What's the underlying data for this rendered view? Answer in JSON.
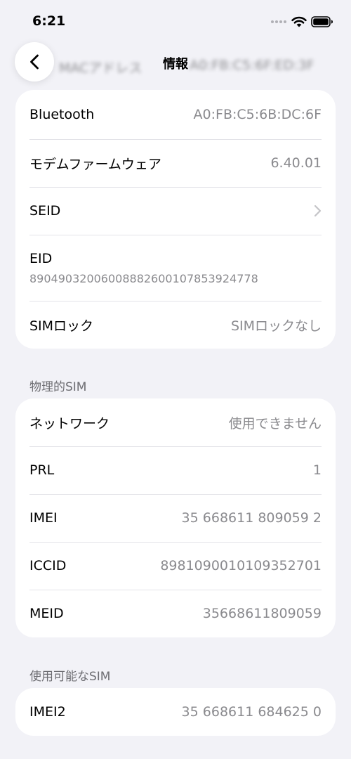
{
  "status_bar": {
    "time": "6:21"
  },
  "nav": {
    "title": "情報",
    "back_icon": "chevron-left-icon",
    "blurred_label": "MACアドレス",
    "blurred_value": "A0:FB:C5:6F:ED:3F"
  },
  "card1": {
    "rows": [
      {
        "label": "Bluetooth",
        "value": "A0:FB:C5:6B:DC:6F"
      },
      {
        "label": "モデムファームウェア",
        "value": "6.40.01"
      },
      {
        "label": "SEID",
        "icon": "chevron-right-icon"
      },
      {
        "label": "EID",
        "value": "89049032006008882600107853924778"
      },
      {
        "label": "SIMロック",
        "value": "SIMロックなし"
      }
    ]
  },
  "section_physical": {
    "header": "物理的SIM",
    "rows": [
      {
        "label": "ネットワーク",
        "value": "使用できません"
      },
      {
        "label": "PRL",
        "value": "1"
      },
      {
        "label": "IMEI",
        "value": "35 668611 809059 2"
      },
      {
        "label": "ICCID",
        "value": "8981090010109352701"
      },
      {
        "label": "MEID",
        "value": "35668611809059"
      }
    ]
  },
  "section_available": {
    "header": "使用可能なSIM",
    "rows": [
      {
        "label": "IMEI2",
        "value": "35 668611 684625 0"
      }
    ]
  },
  "colors": {
    "background": "#f2f2f7",
    "card": "#ffffff",
    "secondary_text": "#8a8a8e",
    "section_header": "#6d6d72"
  }
}
